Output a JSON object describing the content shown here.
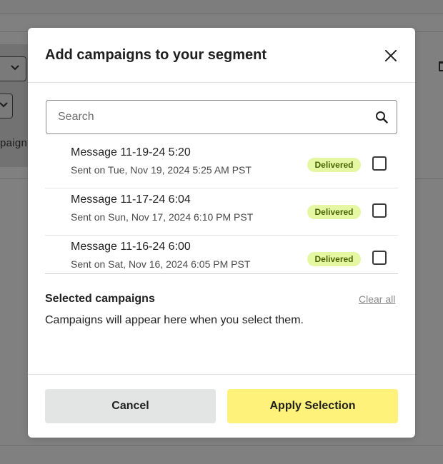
{
  "background": {
    "partial_text": "paign"
  },
  "modal": {
    "title": "Add campaigns to your segment",
    "search": {
      "placeholder": "Search",
      "value": ""
    },
    "campaigns": [
      {
        "title": "Message 11-19-24 5:20",
        "sent": "Sent on Tue, Nov 19, 2024 5:25 AM PST",
        "status": "Delivered",
        "checked": false
      },
      {
        "title": "Message 11-17-24 6:04",
        "sent": "Sent on Sun, Nov 17, 2024 6:10 PM PST",
        "status": "Delivered",
        "checked": false
      },
      {
        "title": "Message 11-16-24 6:00",
        "sent": "Sent on Sat, Nov 16, 2024 6:05 PM PST",
        "status": "Delivered",
        "checked": false
      }
    ],
    "selected": {
      "title": "Selected campaigns",
      "clear_label": "Clear all",
      "empty_text": "Campaigns will appear here when you select them."
    },
    "footer": {
      "cancel_label": "Cancel",
      "apply_label": "Apply Selection"
    }
  },
  "colors": {
    "apply_button": "#fff27a",
    "cancel_button": "#e3e5e5",
    "badge_bg": "#e6f7a3",
    "badge_text": "#476300",
    "overlay": "#808080"
  },
  "icons": {
    "close": "close-icon",
    "search": "search-icon",
    "chevron": "chevron-down-icon",
    "trash": "trash-icon"
  }
}
